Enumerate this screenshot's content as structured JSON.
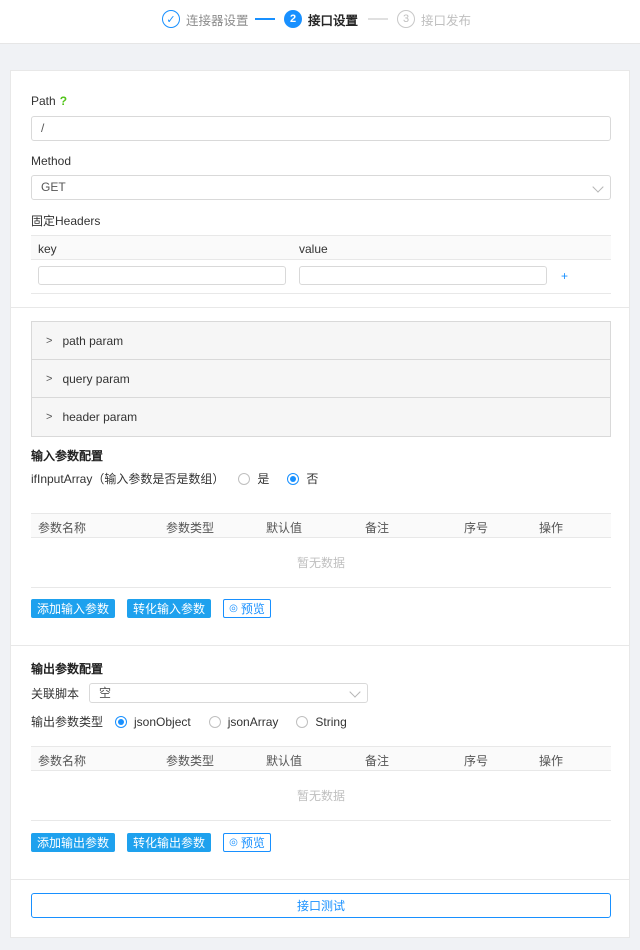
{
  "steps": [
    {
      "label": "连接器设置",
      "icon": "check-icon",
      "num": "✓"
    },
    {
      "label": "接口设置",
      "num": "2"
    },
    {
      "label": "接口发布",
      "num": "3"
    }
  ],
  "colors": {
    "accent": "#1890ff",
    "help": "#52c41a",
    "button_fill": "#1ea1ee"
  },
  "form": {
    "path_label": "Path",
    "path_help": "?",
    "path_value": "/",
    "method_label": "Method",
    "method_value": "GET",
    "headers_label": "固定Headers",
    "headers_columns": [
      "key",
      "value"
    ],
    "add_header": "+"
  },
  "collapse_items": [
    "path param",
    "query param",
    "header param"
  ],
  "input_config": {
    "title": "输入参数配置",
    "array_label": "ifInputArray（输入参数是否是数组）",
    "options": [
      "是",
      "否"
    ],
    "selected": "否",
    "columns": [
      "参数名称",
      "参数类型",
      "默认值",
      "备注",
      "序号",
      "操作"
    ],
    "empty_text": "暂无数据",
    "add_button": "添加输入参数",
    "convert_button": "转化输入参数",
    "preview_button": "预览"
  },
  "output_config": {
    "title": "输出参数配置",
    "script_label": "关联脚本",
    "script_value": "空",
    "type_label": "输出参数类型",
    "type_options": [
      "jsonObject",
      "jsonArray",
      "String"
    ],
    "type_selected": "jsonObject",
    "columns": [
      "参数名称",
      "参数类型",
      "默认值",
      "备注",
      "序号",
      "操作"
    ],
    "empty_text": "暂无数据",
    "add_button": "添加输出参数",
    "convert_button": "转化输出参数",
    "preview_button": "预览"
  },
  "test_button": "接口测试"
}
